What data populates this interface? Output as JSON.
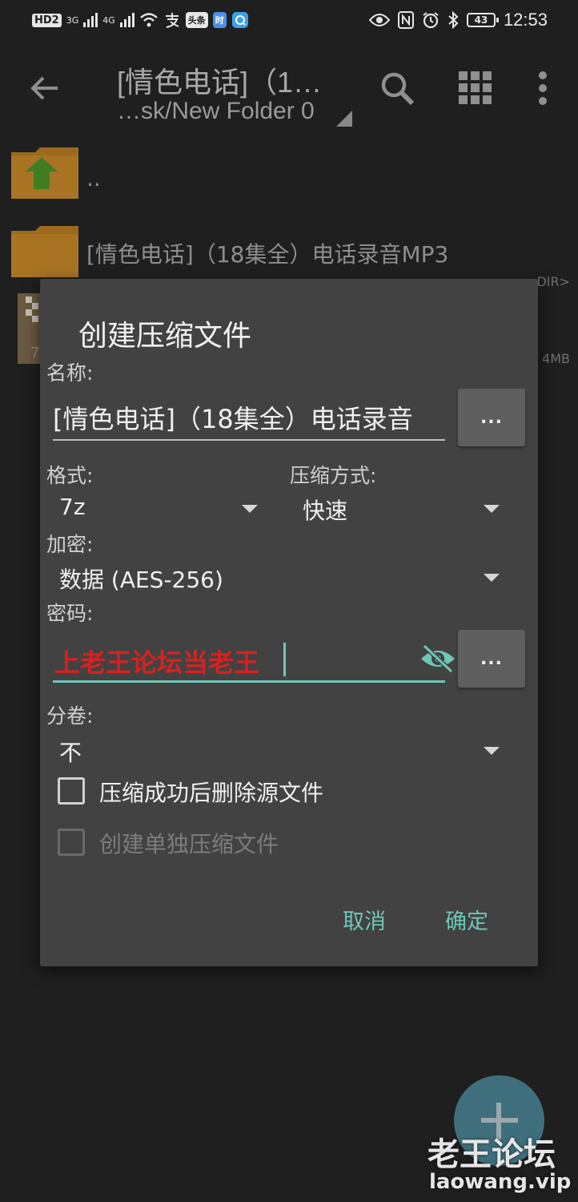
{
  "statusbar": {
    "hd_label": "HD",
    "hd_sim": "2",
    "net_1": "3G",
    "net_2": "4G",
    "app_badge_1": "头条",
    "app_badge_2": "时",
    "battery": "43",
    "time": "12:53"
  },
  "toolbar": {
    "title": "[情色电话]（1…",
    "subtitle": "…sk/New Folder 0"
  },
  "file_list": {
    "rows": [
      {
        "name": "..",
        "meta": ""
      },
      {
        "name": "[情色电话]（18集全）电话录音MP3",
        "meta": "<DIR>"
      },
      {
        "name": "",
        "meta": "4MB",
        "thumb_label": "7"
      }
    ]
  },
  "dialog": {
    "title": "创建压缩文件",
    "name_label": "名称:",
    "name_value": "[情色电话]（18集全）电话录音",
    "browse_label": "...",
    "format_label": "格式:",
    "format_value": "7z",
    "compression_label": "压缩方式:",
    "compression_value": "快速",
    "encryption_label": "加密:",
    "encryption_value": "数据 (AES-256)",
    "password_label": "密码:",
    "password_value": "上老王论坛当老王",
    "split_label": "分卷:",
    "split_value": "不",
    "delete_after_label": "压缩成功后删除源文件",
    "delete_after_checked": false,
    "separate_label": "创建单独压缩文件",
    "separate_checked": false,
    "cancel_label": "取消",
    "ok_label": "确定",
    "accent_color": "#6fc6b7",
    "password_color": "#d82121"
  },
  "watermark": {
    "logo_text": "老王论坛",
    "url": "laowang.vip"
  }
}
